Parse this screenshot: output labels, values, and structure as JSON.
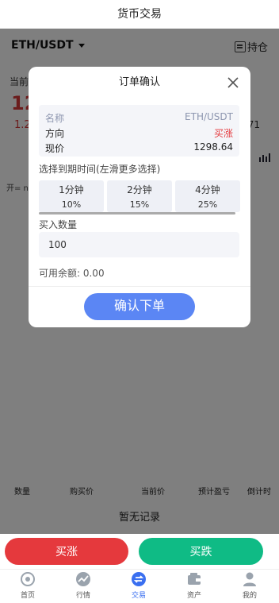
{
  "page": {
    "title": "货币交易"
  },
  "pair": {
    "name": "ETH/USDT",
    "hold_label": "持仓"
  },
  "ticker": {
    "current_label": "当前",
    "price": "12",
    "change": "1.2",
    "right_value": "71",
    "open_label": "开= n"
  },
  "orders_table": {
    "columns": [
      "数量",
      "购买价",
      "当前价",
      "预计盈亏",
      "倒计时"
    ],
    "empty_text": "暂无记录"
  },
  "actions": {
    "buy_up": "买涨",
    "buy_down": "买跌"
  },
  "tabbar": {
    "items": [
      {
        "label": "首页",
        "icon": "home-icon"
      },
      {
        "label": "行情",
        "icon": "market-icon"
      },
      {
        "label": "交易",
        "icon": "trade-icon",
        "active": true
      },
      {
        "label": "资产",
        "icon": "wallet-icon"
      },
      {
        "label": "我的",
        "icon": "user-icon"
      }
    ]
  },
  "modal": {
    "title": "订单确认",
    "info": [
      {
        "key": "名称",
        "value": "ETH/USDT"
      },
      {
        "key": "方向",
        "value": "买涨"
      },
      {
        "key": "现价",
        "value": "1298.64"
      }
    ],
    "period_label": "选择到期时间(左滑更多选择)",
    "periods": [
      {
        "name": "1分钟",
        "rate": "10%"
      },
      {
        "name": "2分钟",
        "rate": "15%"
      },
      {
        "name": "4分钟",
        "rate": "25%"
      }
    ],
    "quantity_label": "买入数量",
    "quantity_value": "100",
    "balance_text": "可用余额: 0.00",
    "confirm_label": "确认下单"
  },
  "colors": {
    "accent": "#5b86f4",
    "up": "#e5393d",
    "down": "#0fbb85",
    "overlay": "rgba(0,0,0,0.5)"
  }
}
